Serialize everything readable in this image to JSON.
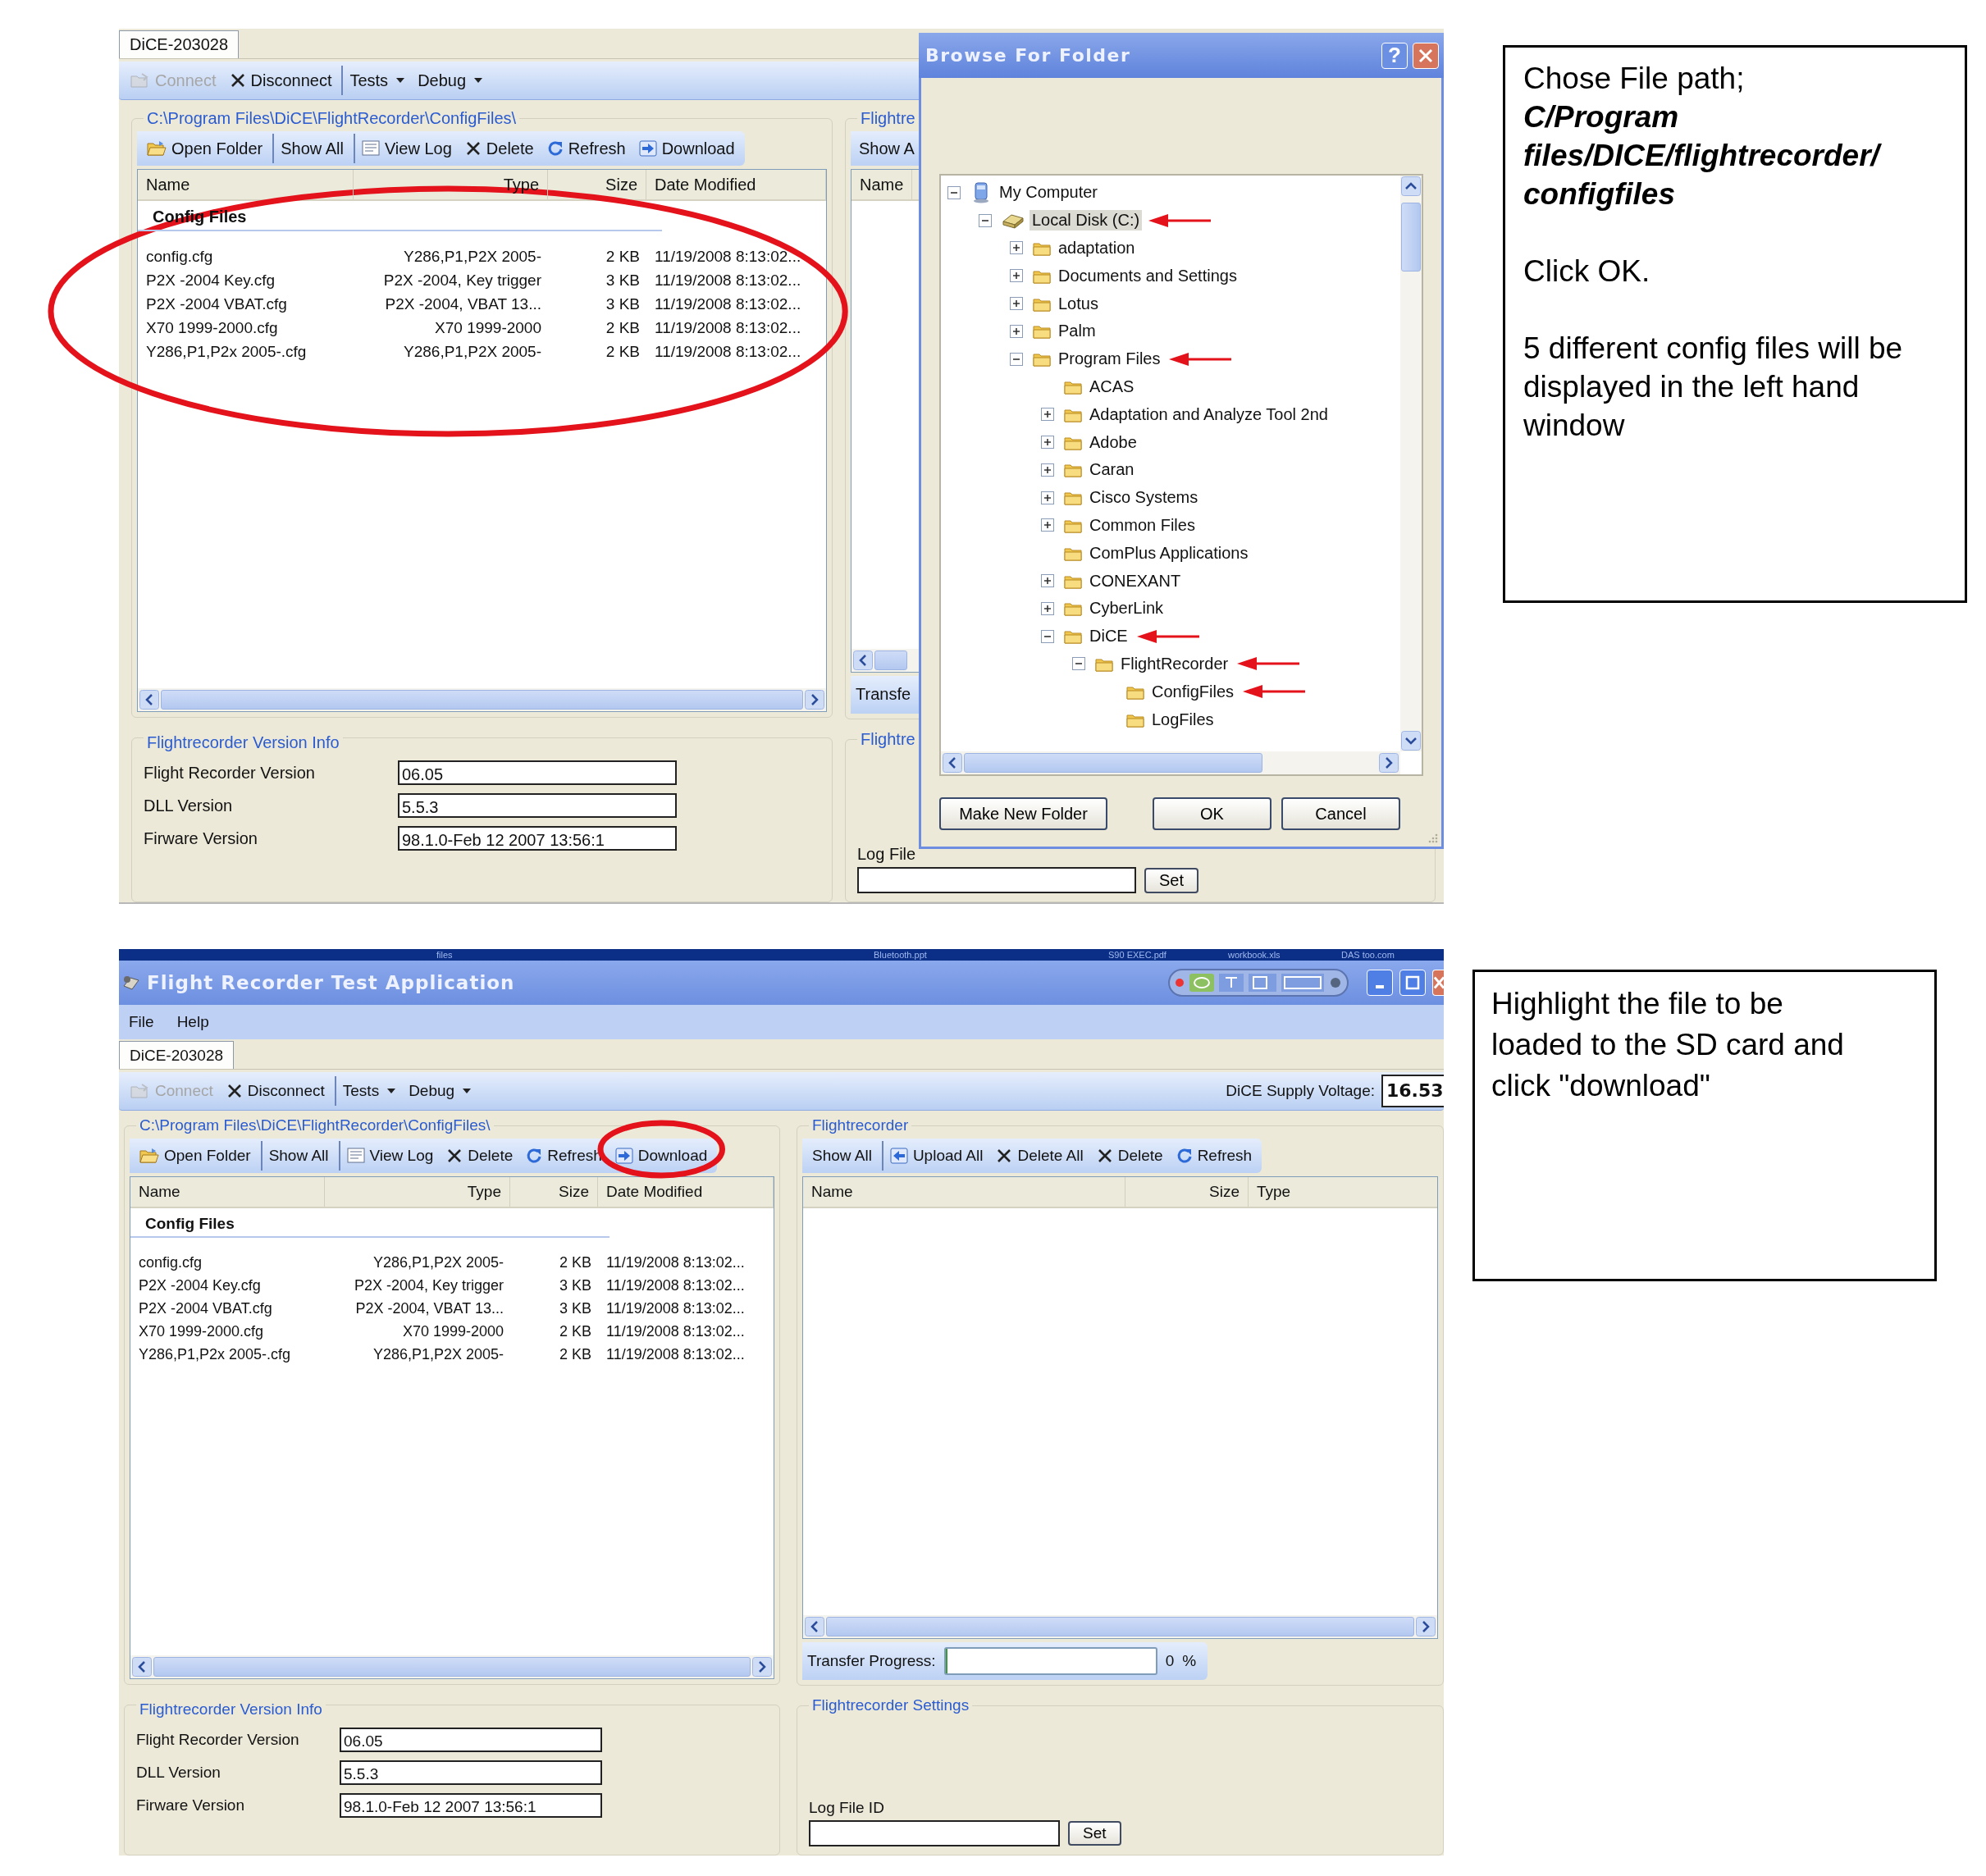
{
  "top_screen": {
    "tabs": [
      {
        "label": "DiCE-203028",
        "selected": true
      }
    ],
    "toolbar": [
      {
        "label": "Connect",
        "kind": "connect",
        "disabled": true,
        "separator": false
      },
      {
        "label": "Disconnect",
        "kind": "close",
        "disabled": false,
        "separator": false
      },
      {
        "label": "Tests",
        "kind": "menu",
        "disabled": false,
        "separator": true
      },
      {
        "label": "Debug",
        "kind": "menu",
        "disabled": false,
        "separator": false
      }
    ],
    "local_files": {
      "path": "C:\\Program Files\\DiCE\\FlightRecorder\\ConfigFiles\\",
      "circled": true,
      "toolbar": [
        {
          "label": "Open Folder",
          "kind": "open",
          "disabled": false,
          "separator": false,
          "circled": false
        },
        {
          "label": "Show All",
          "kind": "plain",
          "disabled": false,
          "separator": true,
          "circled": false
        },
        {
          "label": "View Log",
          "kind": "log",
          "disabled": false,
          "separator": true,
          "circled": false
        },
        {
          "label": "Delete",
          "kind": "close",
          "disabled": false,
          "separator": false,
          "circled": false
        },
        {
          "label": "Refresh",
          "kind": "refresh",
          "disabled": false,
          "separator": false,
          "circled": false
        },
        {
          "label": "Download",
          "kind": "download",
          "disabled": false,
          "separator": false,
          "circled": false
        }
      ],
      "columns": [
        "Name",
        "Type",
        "Size",
        "Date Modified"
      ],
      "group": "Config Files",
      "rows": [
        {
          "cells": [
            "config.cfg",
            "Y286,P1,P2X 2005-",
            "2 KB",
            "11/19/2008 8:13:02..."
          ],
          "selected": false
        },
        {
          "cells": [
            "P2X -2004 Key.cfg",
            "P2X -2004, Key trigger",
            "3 KB",
            "11/19/2008 8:13:02..."
          ],
          "selected": false
        },
        {
          "cells": [
            "P2X -2004 VBAT.cfg",
            "P2X -2004, VBAT 13...",
            "3 KB",
            "11/19/2008 8:13:02..."
          ],
          "selected": false
        },
        {
          "cells": [
            "X70 1999-2000.cfg",
            "X70 1999-2000",
            "2 KB",
            "11/19/2008 8:13:02..."
          ],
          "selected": false
        },
        {
          "cells": [
            "Y286,P1,P2x 2005-.cfg",
            "Y286,P1,P2X 2005-",
            "2 KB",
            "11/19/2008 8:13:02..."
          ],
          "selected": false
        }
      ]
    },
    "version_info": {
      "title": "Flightrecorder Version Info",
      "fields": [
        {
          "label": "Flight Recorder Version",
          "value": "06.05"
        },
        {
          "label": "DLL Version",
          "value": "5.5.3"
        },
        {
          "label": "Firware Version",
          "value": "98.1.0-Feb 12 2007 13:56:1"
        }
      ]
    },
    "recorder_partial": {
      "title": "Flightre",
      "toolbar_label": "Show A",
      "column": "Name",
      "progress_label": "Transfe"
    },
    "settings_partial": {
      "title": "Flightre",
      "log_label": "Log File",
      "button": "Set"
    },
    "dialog": {
      "title": "Browse For Folder",
      "help_button": "?",
      "tree": [
        {
          "label": "My Computer",
          "kind": "computer",
          "expanded": true,
          "selected": false,
          "pointed": false,
          "children": [
            {
              "label": "Local Disk (C:)",
              "kind": "drive",
              "expanded": true,
              "selected": true,
              "pointed": true,
              "children": [
                {
                  "label": "adaptation",
                  "kind": "folder",
                  "expanded": false,
                  "selected": false,
                  "pointed": false
                },
                {
                  "label": "Documents and Settings",
                  "kind": "folder",
                  "expanded": false,
                  "selected": false,
                  "pointed": false
                },
                {
                  "label": "Lotus",
                  "kind": "folder",
                  "expanded": false,
                  "selected": false,
                  "pointed": false
                },
                {
                  "label": "Palm",
                  "kind": "folder",
                  "expanded": false,
                  "selected": false,
                  "pointed": false
                },
                {
                  "label": "Program Files",
                  "kind": "folder",
                  "expanded": true,
                  "selected": false,
                  "pointed": true,
                  "children": [
                    {
                      "label": "ACAS",
                      "kind": "folder",
                      "selected": false,
                      "pointed": false
                    },
                    {
                      "label": "Adaptation and Analyze Tool 2nd",
                      "kind": "folder",
                      "expanded": false,
                      "selected": false,
                      "pointed": false
                    },
                    {
                      "label": "Adobe",
                      "kind": "folder",
                      "expanded": false,
                      "selected": false,
                      "pointed": false
                    },
                    {
                      "label": "Caran",
                      "kind": "folder",
                      "expanded": false,
                      "selected": false,
                      "pointed": false
                    },
                    {
                      "label": "Cisco Systems",
                      "kind": "folder",
                      "expanded": false,
                      "selected": false,
                      "pointed": false
                    },
                    {
                      "label": "Common Files",
                      "kind": "folder",
                      "expanded": false,
                      "selected": false,
                      "pointed": false
                    },
                    {
                      "label": "ComPlus Applications",
                      "kind": "folder",
                      "selected": false,
                      "pointed": false
                    },
                    {
                      "label": "CONEXANT",
                      "kind": "folder",
                      "expanded": false,
                      "selected": false,
                      "pointed": false
                    },
                    {
                      "label": "CyberLink",
                      "kind": "folder",
                      "expanded": false,
                      "selected": false,
                      "pointed": false
                    },
                    {
                      "label": "DiCE",
                      "kind": "folder",
                      "expanded": true,
                      "selected": false,
                      "pointed": true,
                      "children": [
                        {
                          "label": "FlightRecorder",
                          "kind": "folder",
                          "expanded": true,
                          "selected": false,
                          "pointed": true,
                          "children": [
                            {
                              "label": "ConfigFiles",
                              "kind": "folder",
                              "selected": false,
                              "pointed": true
                            },
                            {
                              "label": "LogFiles",
                              "kind": "folder",
                              "selected": false,
                              "pointed": false
                            }
                          ]
                        }
                      ]
                    }
                  ]
                }
              ]
            }
          ]
        }
      ],
      "buttons": [
        "Make New Folder",
        "OK",
        "Cancel"
      ]
    }
  },
  "note_1": {
    "paragraphs": [
      {
        "text": "Chose File path;",
        "path": "C/Program files/DICE/flightrecorder/ configfiles"
      },
      {
        "text": "Click OK."
      },
      {
        "text": "5 different config files will be displayed in the left hand window"
      }
    ]
  },
  "bottom_screen": {
    "taskbar": [
      "files",
      "Bluetooth.ppt",
      "S90 EXEC.pdf",
      "workbook.xls",
      "DAS too.com"
    ],
    "title": "Flight Recorder Test Application",
    "menu": [
      "File",
      "Help"
    ],
    "tabs": [
      {
        "label": "DiCE-203028",
        "selected": true
      }
    ],
    "toolbar": [
      {
        "label": "Connect",
        "kind": "connect",
        "disabled": true,
        "separator": false
      },
      {
        "label": "Disconnect",
        "kind": "close",
        "disabled": false,
        "separator": false
      },
      {
        "label": "Tests",
        "kind": "menu",
        "disabled": false,
        "separator": true
      },
      {
        "label": "Debug",
        "kind": "menu",
        "disabled": false,
        "separator": false
      }
    ],
    "supply": {
      "label": "DiCE Supply Voltage:",
      "value": "16.53"
    },
    "local_files": {
      "path": "C:\\Program Files\\DiCE\\FlightRecorder\\ConfigFiles\\",
      "circled": false,
      "toolbar": [
        {
          "label": "Open Folder",
          "kind": "open",
          "disabled": false,
          "separator": false,
          "circled": false
        },
        {
          "label": "Show All",
          "kind": "plain",
          "disabled": false,
          "separator": true,
          "circled": false
        },
        {
          "label": "View Log",
          "kind": "log",
          "disabled": false,
          "separator": true,
          "circled": false
        },
        {
          "label": "Delete",
          "kind": "close",
          "disabled": false,
          "separator": false,
          "circled": false
        },
        {
          "label": "Refresh",
          "kind": "refresh",
          "disabled": false,
          "separator": false,
          "circled": false
        },
        {
          "label": "Download",
          "kind": "download",
          "disabled": false,
          "separator": false,
          "circled": true
        }
      ],
      "columns": [
        "Name",
        "Type",
        "Size",
        "Date Modified"
      ],
      "group": "Config Files",
      "rows": [
        {
          "cells": [
            "config.cfg",
            "Y286,P1,P2X 2005-",
            "2 KB",
            "11/19/2008 8:13:02..."
          ],
          "selected": false
        },
        {
          "cells": [
            "P2X -2004 Key.cfg",
            "P2X -2004, Key trigger",
            "3 KB",
            "11/19/2008 8:13:02..."
          ],
          "selected": false
        },
        {
          "cells": [
            "P2X -2004 VBAT.cfg",
            "P2X -2004, VBAT 13...",
            "3 KB",
            "11/19/2008 8:13:02..."
          ],
          "selected": false
        },
        {
          "cells": [
            "X70 1999-2000.cfg",
            "X70 1999-2000",
            "2 KB",
            "11/19/2008 8:13:02..."
          ],
          "selected": false
        },
        {
          "cells": [
            "Y286,P1,P2x 2005-.cfg",
            "Y286,P1,P2X 2005-",
            "2 KB",
            "11/19/2008 8:13:02..."
          ],
          "selected": false
        }
      ]
    },
    "recorder": {
      "title": "Flightrecorder",
      "toolbar": [
        {
          "label": "Show All",
          "kind": "plain",
          "disabled": false,
          "separator": false
        },
        {
          "label": "Upload All",
          "kind": "upload",
          "disabled": false,
          "separator": true
        },
        {
          "label": "Delete All",
          "kind": "close",
          "disabled": false,
          "separator": false
        },
        {
          "label": "Delete",
          "kind": "close",
          "disabled": false,
          "separator": false
        },
        {
          "label": "Refresh",
          "kind": "refresh",
          "disabled": false,
          "separator": false
        }
      ],
      "columns": [
        "Name",
        "Size",
        "Type"
      ],
      "progress": {
        "label": "Transfer Progress:",
        "level": 0,
        "value": "0",
        "unit": "%"
      }
    },
    "version_info": {
      "title": "Flightrecorder Version Info",
      "fields": [
        {
          "label": "Flight Recorder Version",
          "value": "06.05"
        },
        {
          "label": "DLL Version",
          "value": "5.5.3"
        },
        {
          "label": "Firware Version",
          "value": "98.1.0-Feb 12 2007 13:56:1"
        }
      ]
    },
    "settings": {
      "title": "Flightrecorder Settings",
      "log_label": "Log File ID",
      "button": "Set"
    }
  },
  "note_2": {
    "text": "Highlight the file to be loaded to the SD card and click \"download\""
  }
}
